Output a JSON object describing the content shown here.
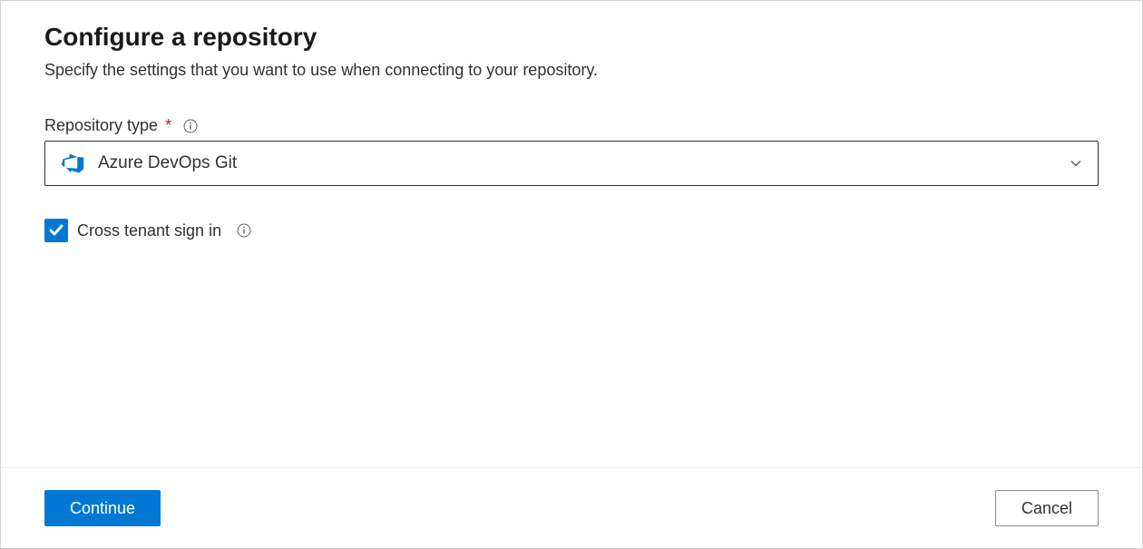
{
  "page": {
    "title": "Configure a repository",
    "subtitle": "Specify the settings that you want to use when connecting to your repository."
  },
  "fields": {
    "repositoryType": {
      "label": "Repository type",
      "required": true,
      "selectedValue": "Azure DevOps Git"
    },
    "crossTenant": {
      "label": "Cross tenant sign in",
      "checked": true
    }
  },
  "footer": {
    "primaryLabel": "Continue",
    "secondaryLabel": "Cancel"
  },
  "colors": {
    "accent": "#0078d4",
    "required": "#a4262c"
  }
}
